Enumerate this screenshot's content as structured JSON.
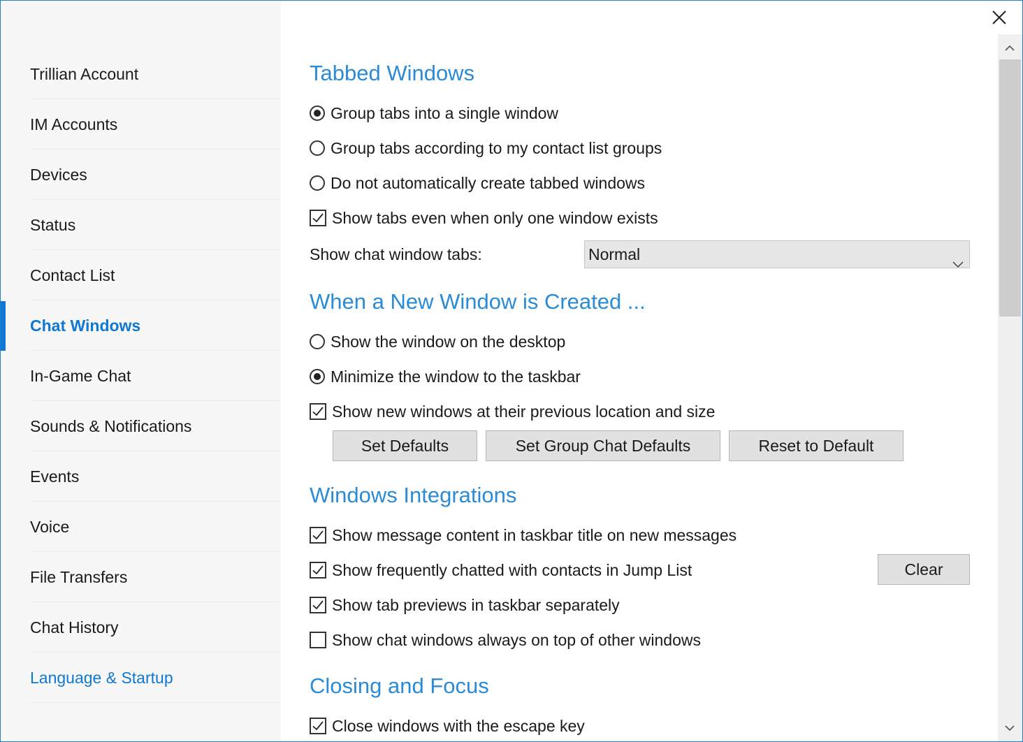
{
  "sidebar": {
    "items": [
      {
        "label": "Trillian Account"
      },
      {
        "label": "IM Accounts"
      },
      {
        "label": "Devices"
      },
      {
        "label": "Status"
      },
      {
        "label": "Contact List"
      },
      {
        "label": "Chat Windows",
        "active": true
      },
      {
        "label": "In-Game Chat"
      },
      {
        "label": "Sounds & Notifications"
      },
      {
        "label": "Events"
      },
      {
        "label": "Voice"
      },
      {
        "label": "File Transfers"
      },
      {
        "label": "Chat History"
      },
      {
        "label": "Language & Startup"
      }
    ]
  },
  "colors": {
    "accent": "#0f78d2",
    "section_title": "#2a8bd6",
    "window_border": "#1e7fd4"
  },
  "close_icon": "close-icon",
  "tabbed_windows": {
    "title": "Tabbed Windows",
    "options": [
      {
        "label": "Group tabs into a single window",
        "type": "radio",
        "checked": true
      },
      {
        "label": "Group tabs according to my contact list groups",
        "type": "radio",
        "checked": false
      },
      {
        "label": "Do not automatically create tabbed windows",
        "type": "radio",
        "checked": false
      },
      {
        "label": "Show tabs even when only one window exists",
        "type": "checkbox",
        "checked": true
      }
    ],
    "tabs_label": "Show chat window tabs:",
    "tabs_value": "Normal"
  },
  "new_window": {
    "title": "When a New Window is Created ...",
    "options": [
      {
        "label": "Show the window on the desktop",
        "type": "radio",
        "checked": false
      },
      {
        "label": "Minimize the window to the taskbar",
        "type": "radio",
        "checked": true
      },
      {
        "label": "Show new windows at their previous location and size",
        "type": "checkbox",
        "checked": true
      }
    ],
    "buttons": {
      "set_defaults": "Set Defaults",
      "set_group_chat_defaults": "Set Group Chat Defaults",
      "reset_to_default": "Reset to Default"
    }
  },
  "windows_integrations": {
    "title": "Windows Integrations",
    "options": [
      {
        "label": "Show message content in taskbar title on new messages",
        "type": "checkbox",
        "checked": true
      },
      {
        "label": "Show frequently chatted with contacts in Jump List",
        "type": "checkbox",
        "checked": true
      },
      {
        "label": "Show tab previews in taskbar separately",
        "type": "checkbox",
        "checked": true
      },
      {
        "label": "Show chat windows always on top of other windows",
        "type": "checkbox",
        "checked": false
      }
    ],
    "clear_label": "Clear"
  },
  "closing_focus": {
    "title": "Closing and Focus",
    "options": [
      {
        "label": "Close windows with the escape key",
        "type": "checkbox",
        "checked": true
      }
    ]
  }
}
